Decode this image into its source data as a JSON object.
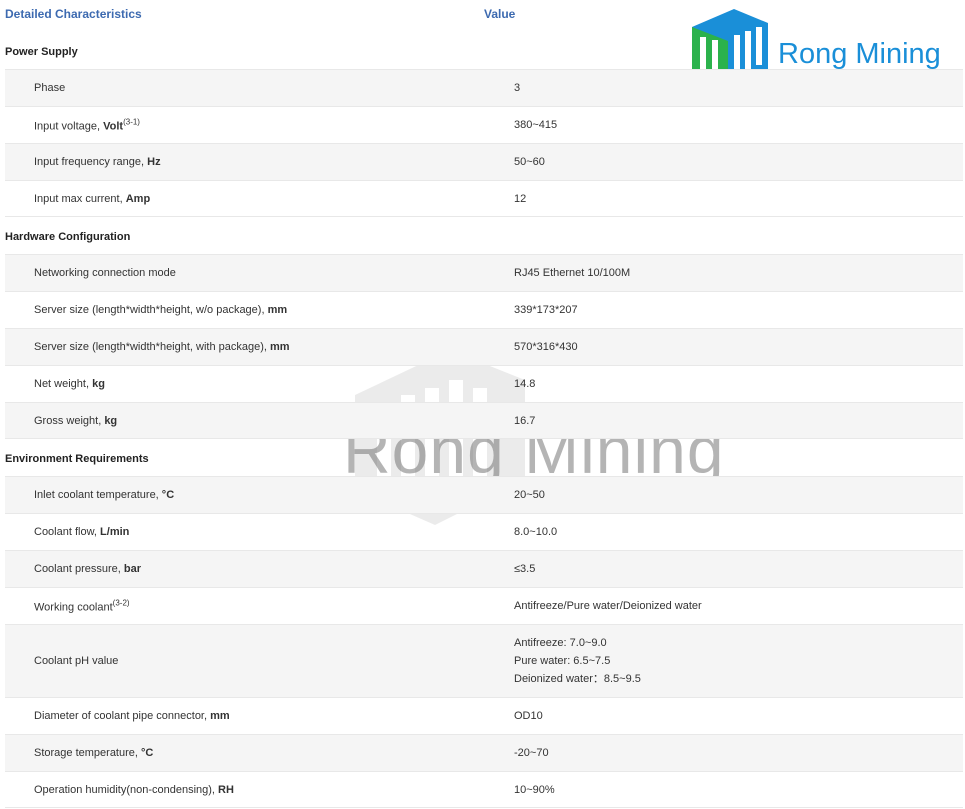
{
  "header": {
    "col1": "Detailed Characteristics",
    "col2": "Value"
  },
  "logo": {
    "text": "Rong Mining"
  },
  "watermark": {
    "text": "Rong Mining"
  },
  "sections": {
    "power": {
      "title": "Power Supply",
      "rows": [
        {
          "label": "Phase",
          "value": "3"
        },
        {
          "label": "Input voltage, ",
          "bold": "Volt",
          "sup": "(3-1)",
          "value": "380~415"
        },
        {
          "label": "Input frequency range, ",
          "bold": "Hz",
          "value": "50~60"
        },
        {
          "label": "Input max current, ",
          "bold": "Amp",
          "value": "12"
        }
      ]
    },
    "hardware": {
      "title": "Hardware Configuration",
      "rows": [
        {
          "label": "Networking connection mode",
          "value": "RJ45 Ethernet 10/100M"
        },
        {
          "label": "Server size (length*width*height, w/o package), ",
          "bold": "mm",
          "value": "339*173*207"
        },
        {
          "label": "Server size (length*width*height, with package), ",
          "bold": "mm",
          "value": "570*316*430"
        },
        {
          "label": "Net weight, ",
          "bold": "kg",
          "value": "14.8"
        },
        {
          "label": "Gross weight, ",
          "bold": "kg",
          "value": "16.7"
        }
      ]
    },
    "environment": {
      "title": "Environment Requirements",
      "rows": [
        {
          "label": "Inlet coolant temperature, ",
          "bold": "°C",
          "value": "20~50"
        },
        {
          "label": "Coolant flow, ",
          "bold": "L/min",
          "value": "8.0~10.0"
        },
        {
          "label": "Coolant pressure, ",
          "bold": "bar",
          "value": "≤3.5"
        },
        {
          "label": "Working coolant",
          "sup": "(3-2)",
          "value": "Antifreeze/Pure water/Deionized water"
        },
        {
          "label": "Coolant pH value",
          "values": [
            "Antifreeze: 7.0~9.0",
            "Pure water: 6.5~7.5",
            "Deionized water：8.5~9.5"
          ]
        },
        {
          "label": "Diameter of coolant pipe connector, ",
          "bold": "mm",
          "value": "OD10"
        },
        {
          "label": "Storage temperature, ",
          "bold": "°C",
          "value": "-20~70"
        },
        {
          "label": "Operation humidity(non-condensing), ",
          "bold": "RH",
          "value": "10~90%"
        }
      ]
    }
  }
}
